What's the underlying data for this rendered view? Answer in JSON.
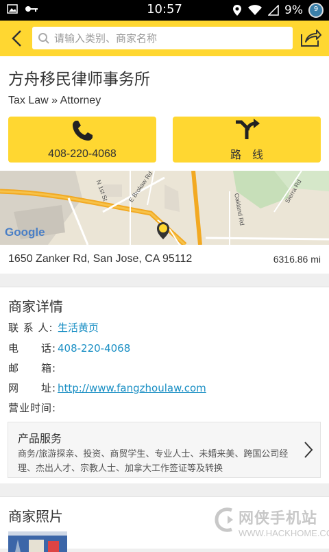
{
  "status_bar": {
    "time": "10:57",
    "battery": "9%",
    "badge": "9"
  },
  "search": {
    "placeholder": "请输入类别、商家名称"
  },
  "business": {
    "name": "方舟移民律师事务所",
    "category": "Tax Law » Attorney",
    "call_label": "408-220-4068",
    "route_label": "路　线",
    "address": "1650 Zanker Rd, San Jose, CA 95112",
    "distance": "6316.86 mi"
  },
  "map": {
    "labels": [
      "N 1st St",
      "E Brokaw Rd",
      "Oakland Rd",
      "Sierra Rd"
    ],
    "logo": "Google"
  },
  "details": {
    "title": "商家详情",
    "contact_label": "联 系 人:",
    "contact_value": "生活黄页",
    "phone_label": "电　　话:",
    "phone_value": "408-220-4068",
    "email_label": "邮　　箱:",
    "website_label": "网　　址:",
    "website_value": "http://www.fangzhoulaw.com",
    "hours_label": "营业时间:",
    "services_title": "产品服务",
    "services_text": "商务/旅游探亲、投资、商贸学生、专业人士、未婚来美、跨国公司经理、杰出人才、宗教人士、加拿大工作签证等及转换"
  },
  "photos": {
    "title": "商家照片"
  },
  "watermark": {
    "title": "网侠手机站",
    "url": "WWW.HACKHOME.COM"
  },
  "colors": {
    "accent": "#ffd731",
    "link": "#1a8fc4"
  }
}
